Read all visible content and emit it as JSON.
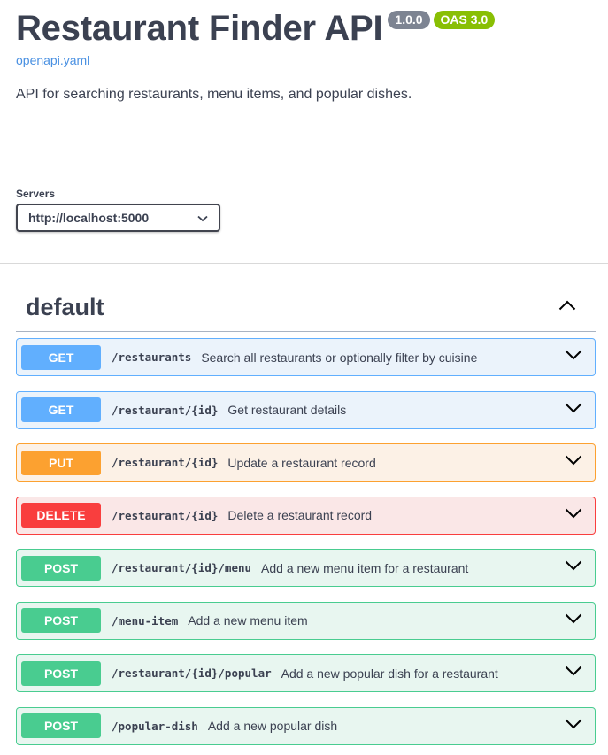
{
  "info": {
    "title": "Restaurant Finder API",
    "version": "1.0.0",
    "oas": "OAS 3.0",
    "spec_link": "openapi.yaml",
    "description": "API for searching restaurants, menu items, and popular dishes."
  },
  "servers": {
    "label": "Servers",
    "selected": "http://localhost:5000"
  },
  "section": {
    "title": "default"
  },
  "operations": [
    {
      "method": "GET",
      "path": "/restaurants",
      "summary": "Search all restaurants or optionally filter by cuisine"
    },
    {
      "method": "GET",
      "path": "/restaurant/{id}",
      "summary": "Get restaurant details"
    },
    {
      "method": "PUT",
      "path": "/restaurant/{id}",
      "summary": "Update a restaurant record"
    },
    {
      "method": "DELETE",
      "path": "/restaurant/{id}",
      "summary": "Delete a restaurant record"
    },
    {
      "method": "POST",
      "path": "/restaurant/{id}/menu",
      "summary": "Add a new menu item for a restaurant"
    },
    {
      "method": "POST",
      "path": "/menu-item",
      "summary": "Add a new menu item"
    },
    {
      "method": "POST",
      "path": "/restaurant/{id}/popular",
      "summary": "Add a new popular dish for a restaurant"
    },
    {
      "method": "POST",
      "path": "/popular-dish",
      "summary": "Add a new popular dish"
    }
  ],
  "colors": {
    "get": "#61affe",
    "put": "#fca130",
    "delete": "#f93e3e",
    "post": "#49cc90"
  }
}
